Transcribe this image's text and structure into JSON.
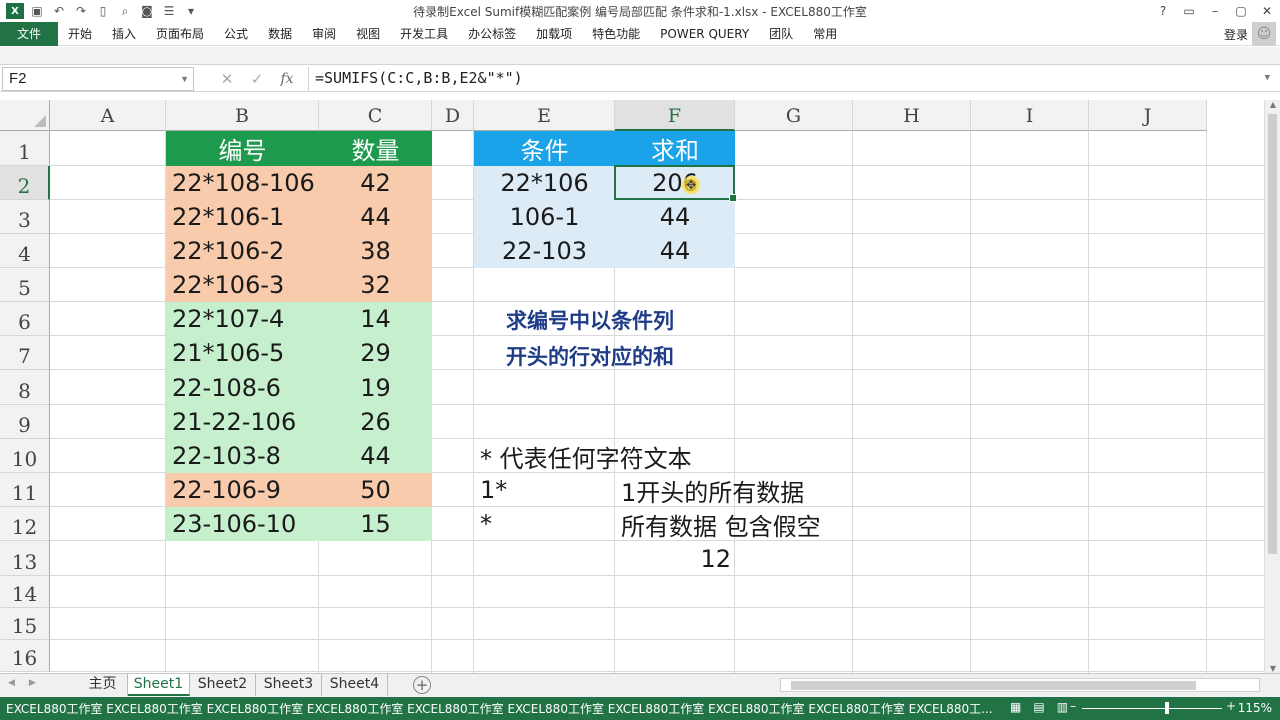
{
  "window": {
    "title": "待录制Excel Sumif模糊匹配案例 编号局部匹配 条件求和-1.xlsx - EXCEL880工作室",
    "controls": [
      "?",
      "▭",
      "–",
      "▢",
      "✕"
    ]
  },
  "ribbon": {
    "file": "文件",
    "tabs": [
      "开始",
      "插入",
      "页面布局",
      "公式",
      "数据",
      "审阅",
      "视图",
      "开发工具",
      "办公标签",
      "加载项",
      "特色功能",
      "POWER QUERY",
      "团队",
      "常用"
    ],
    "login": "登录"
  },
  "formula_bar": {
    "name_box": "F2",
    "formula": "=SUMIFS(C:C,B:B,E2&\"*\")"
  },
  "columns": [
    "A",
    "B",
    "C",
    "D",
    "E",
    "F",
    "G",
    "H",
    "I",
    "J"
  ],
  "rows": [
    "1",
    "2",
    "3",
    "4",
    "5",
    "6",
    "7",
    "8",
    "9",
    "10",
    "11",
    "12",
    "13",
    "14",
    "15",
    "16"
  ],
  "table1": {
    "header": [
      "编号",
      "数量"
    ],
    "rows": [
      {
        "id": "22*108-106",
        "qty": "42",
        "color": "orange"
      },
      {
        "id": "22*106-1",
        "qty": "44",
        "color": "orange"
      },
      {
        "id": "22*106-2",
        "qty": "38",
        "color": "orange"
      },
      {
        "id": "22*106-3",
        "qty": "32",
        "color": "orange"
      },
      {
        "id": "22*107-4",
        "qty": "14",
        "color": "green"
      },
      {
        "id": "21*106-5",
        "qty": "29",
        "color": "green"
      },
      {
        "id": "22-108-6",
        "qty": "19",
        "color": "green"
      },
      {
        "id": "21-22-106",
        "qty": "26",
        "color": "green"
      },
      {
        "id": "22-103-8",
        "qty": "44",
        "color": "green"
      },
      {
        "id": "22-106-9",
        "qty": "50",
        "color": "orange"
      },
      {
        "id": "23-106-10",
        "qty": "15",
        "color": "green"
      }
    ]
  },
  "table2": {
    "header": [
      "条件",
      "求和"
    ],
    "rows": [
      {
        "cond": "22*106",
        "sum": "206"
      },
      {
        "cond": "106-1",
        "sum": "44"
      },
      {
        "cond": "22-103",
        "sum": "44"
      }
    ]
  },
  "note": {
    "line1": "求编号中以条件列",
    "line2": "开头的行对应的和"
  },
  "explain": {
    "e10": "* 代表任何字符文本",
    "e11": "1*",
    "f11": "1开头的所有数据",
    "e12": "*",
    "f12": "所有数据 包含假空",
    "f13": "12"
  },
  "sheets": {
    "tabs": [
      "主页",
      "Sheet1",
      "Sheet2",
      "Sheet3",
      "Sheet4"
    ],
    "active": "Sheet1"
  },
  "status": {
    "marquee": "EXCEL880工作室 EXCEL880工作室 EXCEL880工作室 EXCEL880工作室 EXCEL880工作室 EXCEL880工作室 EXCEL880工作室 EXCEL880工作室 EXCEL880工作室 EXCEL880工...",
    "zoom": "115%"
  },
  "colors": {
    "excel_green": "#217346",
    "header_green": "#1e9a4f",
    "header_blue": "#1aa3e8",
    "orange_fill": "#f8cbad",
    "green_fill": "#c6efce",
    "blue_fill": "#ddebf7",
    "note_text": "#1f3c88"
  }
}
